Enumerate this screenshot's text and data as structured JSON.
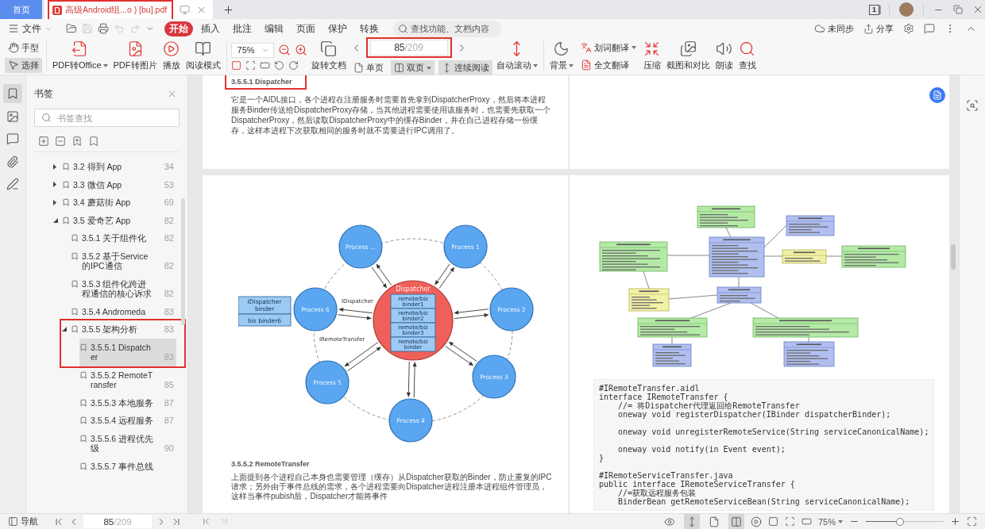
{
  "tabs": {
    "home": "首页",
    "documents": [
      {
        "title": "高级Android组...o ) [bu].pdf",
        "selected": true,
        "highlighted": true
      }
    ],
    "window_badge": "1"
  },
  "menu": {
    "file": "文件",
    "quick_actions": [
      {
        "disabled": false
      },
      {
        "disabled": true
      },
      {
        "disabled": false
      },
      {
        "disabled": true
      },
      {
        "disabled": true
      }
    ],
    "tabs": [
      {
        "label": "开始",
        "selected": true
      },
      {
        "label": "插入",
        "selected": false
      },
      {
        "label": "批注",
        "selected": false
      },
      {
        "label": "编辑",
        "selected": false
      },
      {
        "label": "页面",
        "selected": false
      },
      {
        "label": "保护",
        "selected": false
      },
      {
        "label": "转换",
        "selected": false
      }
    ],
    "search": {
      "placeholder": "查找功能、文档内容"
    },
    "sync": "未同步",
    "share": "分享"
  },
  "toolbar": {
    "tools": [
      {
        "label": "手型",
        "selected": false
      },
      {
        "label": "选择",
        "selected": true
      }
    ],
    "convert": [
      {
        "label": "PDF转Office",
        "dropdown": true
      },
      {
        "label": "PDF转图片",
        "dropdown": false
      },
      {
        "label": "播放",
        "dropdown": false
      },
      {
        "label": "阅读模式",
        "dropdown": false
      }
    ],
    "zoom": "75%",
    "rotate": "旋转文档",
    "page": {
      "current": "85",
      "total": "/209",
      "highlighted": true
    },
    "layouts": [
      {
        "label": "单页",
        "selected": false,
        "dropdown": false
      },
      {
        "label": "双页",
        "selected": true,
        "dropdown": true
      },
      {
        "label": "连续阅读",
        "selected": true,
        "dropdown": false
      }
    ],
    "auto_scroll": {
      "label": "自动滚动",
      "dropdown": true
    },
    "background": {
      "label": "背景",
      "dropdown": true
    },
    "translate": [
      {
        "label": "划词翻译",
        "dropdown": true
      },
      {
        "label": "全文翻译",
        "dropdown": false
      }
    ],
    "tools_right": [
      {
        "label": "压缩"
      },
      {
        "label": "截图和对比"
      },
      {
        "label": "朗读"
      },
      {
        "label": "查找"
      }
    ]
  },
  "side_rail": [
    {
      "selected": true
    },
    {
      "selected": false
    },
    {
      "selected": false
    },
    {
      "selected": false
    },
    {
      "selected": false
    }
  ],
  "bookmarks": {
    "title": "书签",
    "search": {
      "placeholder": "书签查找"
    },
    "items": [
      {
        "label": "3.2 得到 App",
        "page": "34",
        "expanded": false,
        "selected": false,
        "highlighted": false
      },
      {
        "label": "3.3 微信 App",
        "page": "53",
        "expanded": false,
        "selected": false,
        "highlighted": false
      },
      {
        "label": "3.4 蘑菇街 App",
        "page": "69",
        "expanded": false,
        "selected": false,
        "highlighted": false
      },
      {
        "label": "3.5 爱奇艺 App",
        "page": "82",
        "expanded": true,
        "selected": false,
        "highlighted": false,
        "children": [
          {
            "label": "3.5.1 关于组件化",
            "page": "82",
            "selected": false,
            "highlighted": false
          },
          {
            "label": "3.5.2 基于Service的IPC通信",
            "page": "82",
            "selected": false,
            "highlighted": false
          },
          {
            "label": "3.5.3 组件化跨进程通信的核心诉求",
            "page": "82",
            "selected": false,
            "highlighted": false
          },
          {
            "label": "3.5.4 Andromeda",
            "page": "83",
            "selected": false,
            "highlighted": false
          },
          {
            "label": "3.5.5 架构分析",
            "page": "83",
            "expanded": true,
            "selected": false,
            "highlighted": true,
            "children": [
              {
                "label": "3.5.5.1 Dispatcher",
                "page": "83",
                "selected": true,
                "highlighted": true
              },
              {
                "label": "3.5.5.2 RemoteTransfer",
                "page": "85",
                "selected": false,
                "highlighted": false
              },
              {
                "label": "3.5.5.3 本地服务",
                "page": "87",
                "selected": false,
                "highlighted": false
              },
              {
                "label": "3.5.5.4 远程服务",
                "page": "87",
                "selected": false,
                "highlighted": false
              },
              {
                "label": "3.5.5.6 进程优先级",
                "page": "90",
                "selected": false,
                "highlighted": false
              },
              {
                "label": "3.5.5.7 事件总线",
                "selected": false,
                "highlighted": false
              }
            ]
          }
        ]
      }
    ]
  },
  "document": {
    "top_left": {
      "heading": {
        "text": "3.5.5.1 Dispatcher",
        "highlighted": true
      },
      "paragraph": "它是一个AIDL接口，各个进程在注册服务时需要首先拿到DispatcherProxy，然后将本进程服务Binder传送给DispatcherProxy存储，当其他进程需要使用该服务时，也需要先获取一个DispatcherProxy，然后读取DispatcherProxy中的缓存Binder，并在自己进程存储一份缓存，这样本进程下次获取相同的服务时就不需要进行IPC调用了。"
    },
    "bottom_left": {
      "diagram": {
        "hub": {
          "label": "Dispatcher",
          "slots": [
            "remote/biz binder1",
            "remote/biz binder2",
            "remote/biz binder3",
            "remote/biz binder"
          ]
        },
        "nodes": [
          {
            "label": "Process ..."
          },
          {
            "label": "Process 1"
          },
          {
            "label": "Process 2"
          },
          {
            "label": "Process 3"
          },
          {
            "label": "Process 4"
          },
          {
            "label": "Process 5"
          },
          {
            "label": "Process 6"
          }
        ],
        "side_box": [
          "IDispatcher binder",
          "biz binder6"
        ],
        "edge_labels": [
          "IDispatcher",
          "IRemoteTransfer"
        ]
      },
      "heading": "3.5.5.2 RemoteTransfer",
      "paragraph": "上面提到各个进程自己本身也需要管理（缓存）从Dispatcher获取的Binder，防止重复的IPC请求；另外由于事件总线的需求，各个进程需要向Dispatcher进程注册本进程组件管理员，这样当事件pubish后，Dispatcher才能将事件"
    },
    "bottom_right": {
      "code": "#IRemoteTransfer.aidl\ninterface IRemoteTransfer {\n    //= 将Dispatcher代理返回给RemoteTransfer\n    oneway void registerDispatcher(IBinder dispatcherBinder);\n\n    oneway void unregisterRemoteService(String serviceCanonicalName);\n\n    oneway void notify(in Event event);\n}\n\n#IRemoteServiceTransfer.java\npublic interface IRemoteServiceTransfer {\n    //=获取远程服务包装\n    BinderBean getRemoteServiceBean(String serviceCanonicalName);"
    }
  },
  "status_bar": {
    "nav": "导航",
    "page": {
      "current": "85",
      "total": "/209"
    },
    "view_buttons": [
      {
        "selected": false
      },
      {
        "selected": true
      },
      {
        "selected": false
      },
      {
        "selected": true
      }
    ],
    "zoom": "75%",
    "zoom_slider": {
      "level": 0.43
    }
  }
}
